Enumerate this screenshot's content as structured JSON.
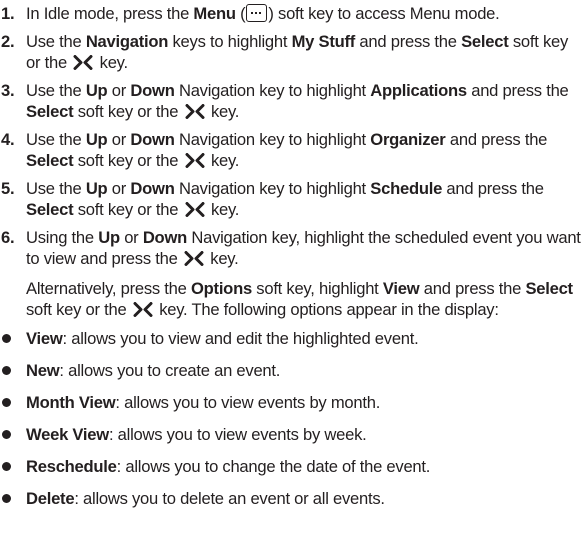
{
  "steps": [
    {
      "num": "1.",
      "parts": [
        {
          "t": "In Idle mode, press the "
        },
        {
          "t": "Menu",
          "b": true
        },
        {
          "t": " ("
        },
        {
          "icon": "menu"
        },
        {
          "t": ") soft key to access Menu mode."
        }
      ]
    },
    {
      "num": "2.",
      "parts": [
        {
          "t": "Use the "
        },
        {
          "t": "Navigation",
          "b": true
        },
        {
          "t": " keys to highlight "
        },
        {
          "t": "My Stuff",
          "b": true
        },
        {
          "t": " and press the "
        },
        {
          "t": "Select",
          "b": true
        },
        {
          "t": " soft key or the "
        },
        {
          "icon": "ok"
        },
        {
          "t": " key."
        }
      ]
    },
    {
      "num": "3.",
      "parts": [
        {
          "t": "Use the "
        },
        {
          "t": "Up",
          "b": true
        },
        {
          "t": " or "
        },
        {
          "t": "Down",
          "b": true
        },
        {
          "t": " Navigation key to highlight "
        },
        {
          "t": "Applications",
          "b": true
        },
        {
          "t": " and press the "
        },
        {
          "t": "Select",
          "b": true
        },
        {
          "t": " soft key or the "
        },
        {
          "icon": "ok"
        },
        {
          "t": " key."
        }
      ]
    },
    {
      "num": "4.",
      "parts": [
        {
          "t": "Use the "
        },
        {
          "t": "Up",
          "b": true
        },
        {
          "t": " or "
        },
        {
          "t": "Down",
          "b": true
        },
        {
          "t": " Navigation key to highlight "
        },
        {
          "t": "Organizer",
          "b": true
        },
        {
          "t": " and press the "
        },
        {
          "t": "Select",
          "b": true
        },
        {
          "t": " soft key or the "
        },
        {
          "icon": "ok"
        },
        {
          "t": " key."
        }
      ]
    },
    {
      "num": "5.",
      "parts": [
        {
          "t": "Use the "
        },
        {
          "t": "Up",
          "b": true
        },
        {
          "t": " or "
        },
        {
          "t": "Down",
          "b": true
        },
        {
          "t": " Navigation key to highlight "
        },
        {
          "t": "Schedule",
          "b": true
        },
        {
          "t": " and press the "
        },
        {
          "t": "Select",
          "b": true
        },
        {
          "t": " soft key or the "
        },
        {
          "icon": "ok"
        },
        {
          "t": " key."
        }
      ]
    },
    {
      "num": "6.",
      "parts": [
        {
          "t": "Using the "
        },
        {
          "t": "Up",
          "b": true
        },
        {
          "t": " or "
        },
        {
          "t": "Down",
          "b": true
        },
        {
          "t": " Navigation key, highlight the scheduled event you want to view and press the "
        },
        {
          "icon": "ok"
        },
        {
          "t": " key."
        }
      ]
    }
  ],
  "alternative": [
    {
      "t": "Alternatively, press the "
    },
    {
      "t": "Options",
      "b": true
    },
    {
      "t": " soft key, highlight "
    },
    {
      "t": "View",
      "b": true
    },
    {
      "t": " and press the "
    },
    {
      "t": "Select",
      "b": true
    },
    {
      "t": " soft key or the "
    },
    {
      "icon": "ok"
    },
    {
      "t": " key. The following options appear in the display:"
    }
  ],
  "options": [
    {
      "term": "View",
      "desc": ": allows you to view and edit the highlighted event."
    },
    {
      "term": "New",
      "desc": ": allows you to create an event."
    },
    {
      "term": "Month View",
      "desc": ": allows you to view events by month."
    },
    {
      "term": "Week View",
      "desc": ": allows you to view events by week."
    },
    {
      "term": "Reschedule",
      "desc": ": allows you to change the date of the event."
    },
    {
      "term": "Delete",
      "desc": ": allows you to delete an event or all events."
    }
  ]
}
